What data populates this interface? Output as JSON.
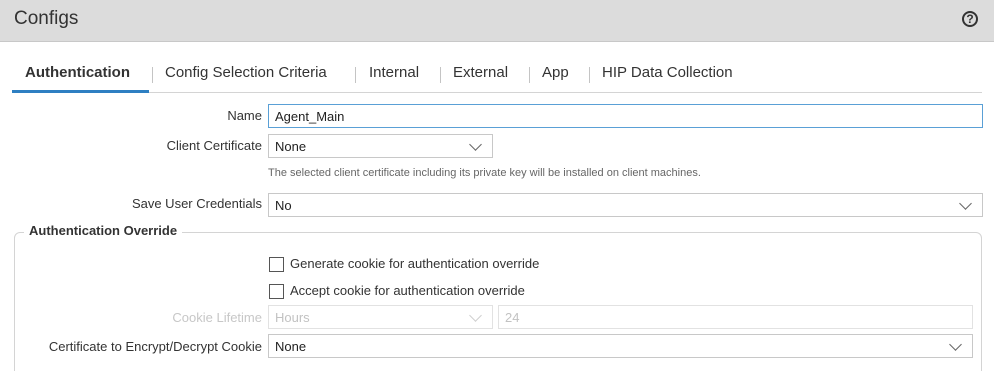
{
  "window": {
    "title": "Configs",
    "help_icon": "?"
  },
  "tabs": [
    {
      "label": "Authentication",
      "active": true
    },
    {
      "label": "Config Selection Criteria",
      "active": false
    },
    {
      "label": "Internal",
      "active": false
    },
    {
      "label": "External",
      "active": false
    },
    {
      "label": "App",
      "active": false
    },
    {
      "label": "HIP Data Collection",
      "active": false
    }
  ],
  "form": {
    "name": {
      "label": "Name",
      "value": "Agent_Main"
    },
    "client_certificate": {
      "label": "Client Certificate",
      "value": "None",
      "hint": "The selected client certificate including its private key will be installed on client machines."
    },
    "save_user_credentials": {
      "label": "Save User Credentials",
      "value": "No"
    }
  },
  "auth_override": {
    "legend": "Authentication Override",
    "generate_cookie": {
      "label": "Generate cookie for authentication override",
      "checked": false
    },
    "accept_cookie": {
      "label": "Accept cookie for authentication override",
      "checked": false
    },
    "cookie_lifetime": {
      "label": "Cookie Lifetime",
      "unit": "Hours",
      "value": "24",
      "disabled": true
    },
    "cert_encrypt": {
      "label": "Certificate to Encrypt/Decrypt Cookie",
      "value": "None"
    }
  },
  "colors": {
    "accent": "#2e7fc2",
    "titlebar_bg": "#dcdcdc",
    "focus_border": "#5aa0d6"
  }
}
